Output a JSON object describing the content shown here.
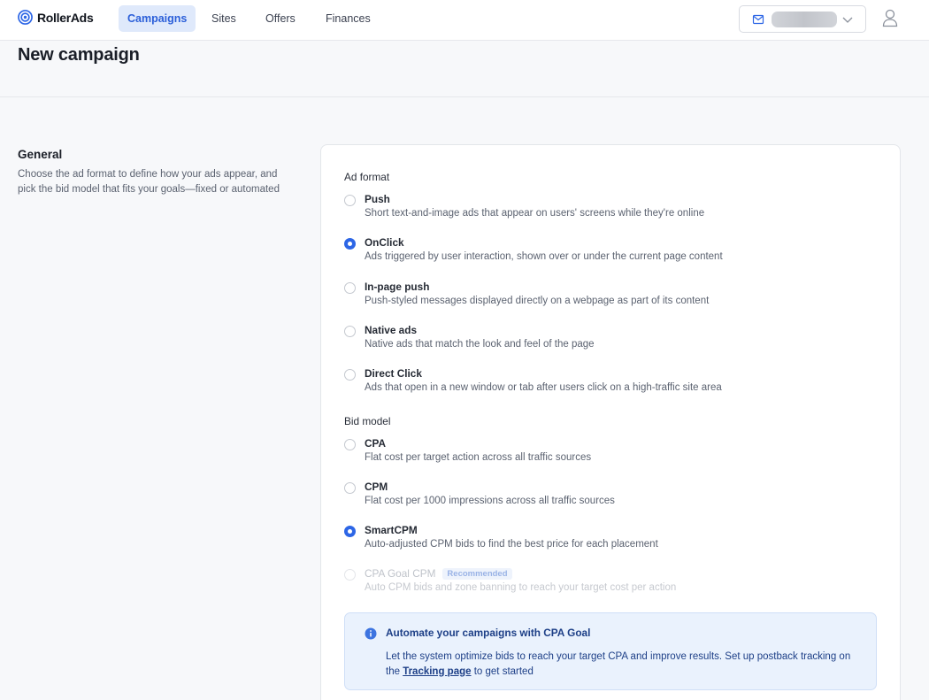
{
  "app": {
    "name": "RollerAds"
  },
  "nav": {
    "items": [
      {
        "label": "Campaigns",
        "active": true
      },
      {
        "label": "Sites",
        "active": false
      },
      {
        "label": "Offers",
        "active": false
      },
      {
        "label": "Finances",
        "active": false
      }
    ]
  },
  "account": {
    "icon": "mail-icon",
    "value_blurred": true
  },
  "page": {
    "title": "New campaign"
  },
  "general": {
    "title": "General",
    "description": "Choose the ad format to define how your ads appear, and pick the bid model that fits your goals—fixed or automated"
  },
  "ad_format": {
    "label": "Ad format",
    "options": [
      {
        "title": "Push",
        "description": "Short text-and-image ads that appear on users' screens while they're online",
        "checked": false
      },
      {
        "title": "OnClick",
        "description": "Ads triggered by user interaction, shown over or under the current page content",
        "checked": true
      },
      {
        "title": "In-page push",
        "description": "Push-styled messages displayed directly on a webpage as part of its content",
        "checked": false
      },
      {
        "title": "Native ads",
        "description": "Native ads that match the look and feel of the page",
        "checked": false
      },
      {
        "title": "Direct Click",
        "description": "Ads that open in a new window or tab after users click on a high-traffic site area",
        "checked": false
      }
    ]
  },
  "bid_model": {
    "label": "Bid model",
    "options": [
      {
        "title": "CPA",
        "description": "Flat cost per target action across all traffic sources",
        "checked": false
      },
      {
        "title": "CPM",
        "description": "Flat cost per 1000 impressions across all traffic sources",
        "checked": false
      },
      {
        "title": "SmartCPM",
        "description": "Auto-adjusted CPM bids to find the best price for each placement",
        "checked": true
      },
      {
        "title": "CPA Goal CPM",
        "badge": "Recommended",
        "description": "Auto CPM bids and zone banning to reach your target cost per action",
        "checked": false,
        "disabled": true
      }
    ]
  },
  "info": {
    "title": "Automate your campaigns with CPA Goal",
    "body_before": "Let the system optimize bids to reach your target CPA and improve results. Set up postback tracking on the ",
    "link": "Tracking page",
    "body_after": " to get started"
  },
  "colors": {
    "accent": "#2d66e6",
    "nav_active_bg": "#dfe9fb",
    "info_bg": "#eaf2fd",
    "info_text": "#1d3f87"
  }
}
